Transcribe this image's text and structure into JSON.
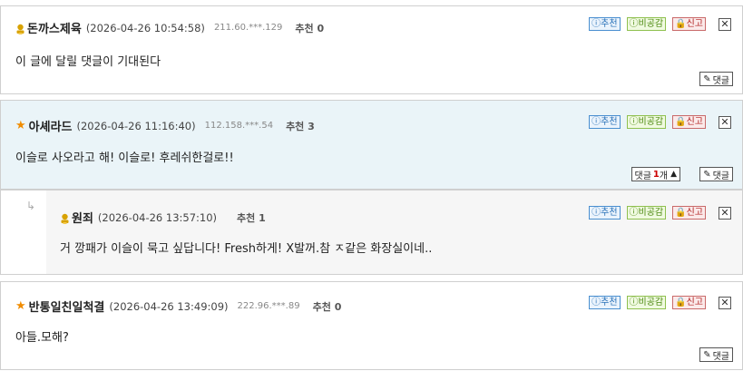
{
  "buttons": {
    "upvote": "ⓘ추천",
    "downvote": "ⓘ비공감",
    "report": "🔒신고",
    "close": "✕",
    "reply": "댓글",
    "reply_count_label": "댓글",
    "reply_count_unit": "개"
  },
  "comments": [
    {
      "nick": "돈까스제육",
      "date": "(2026-04-26 10:54:58)",
      "ip": "211.60.***.129",
      "rec_label": "추천",
      "rec": "0",
      "text": "이 글에 달릴 댓글이 기대된다"
    },
    {
      "nick": "아셰라드",
      "date": "(2026-04-26 11:16:40)",
      "ip": "112.158.***.54",
      "rec_label": "추천",
      "rec": "3",
      "text": "이슬로 사오라고 해! 이슬로! 후레쉬한걸로!!",
      "reply_count": "1"
    },
    {
      "nick": "원죄",
      "date": "(2026-04-26 13:57:10)",
      "ip": "",
      "rec_label": "추천",
      "rec": "1",
      "text": "거 깡패가 이슬이 묵고 싶답니다! Fresh하게! X발꺼.참 ㅈ같은 화장실이네.."
    },
    {
      "nick": "반통일친일척결",
      "date": "(2026-04-26 13:49:09)",
      "ip": "222.96.***.89",
      "rec_label": "추천",
      "rec": "0",
      "text": "아들.모해?"
    }
  ],
  "colors": {
    "highlight_bg": "#eaf4f8",
    "star": "#f08c00",
    "reply_count": "#cc0000"
  }
}
